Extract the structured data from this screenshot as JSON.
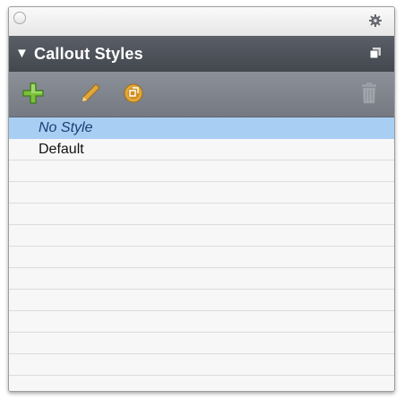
{
  "panel": {
    "title": "Callout Styles",
    "collapse_glyph": "▼",
    "icons": {
      "close": "close-icon",
      "settings": "gear-icon",
      "menu": "panel-menu-icon"
    }
  },
  "toolbar": {
    "add": "plus-icon",
    "edit": "pencil-icon",
    "duplicate": "duplicate-icon",
    "delete": "trash-icon",
    "colors": {
      "add": "#7bc23a",
      "edit": "#e0a83a",
      "duplicate": "#e0a83a"
    }
  },
  "styles": [
    {
      "label": "No Style",
      "selected": true
    },
    {
      "label": "Default",
      "selected": false
    }
  ],
  "colors": {
    "header": "#4c5058",
    "toolbar": "#80858e",
    "selection": "#a9cef3"
  }
}
